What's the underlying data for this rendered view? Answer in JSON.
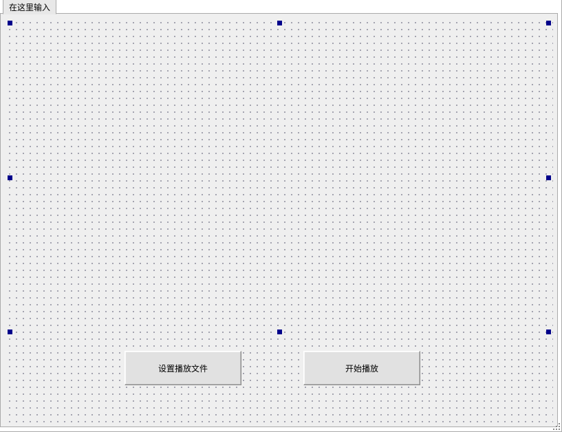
{
  "designer": {
    "tab_label": "在这里输入",
    "buttons": {
      "set_file_label": "设置播放文件",
      "start_play_label": "开始播放"
    }
  }
}
